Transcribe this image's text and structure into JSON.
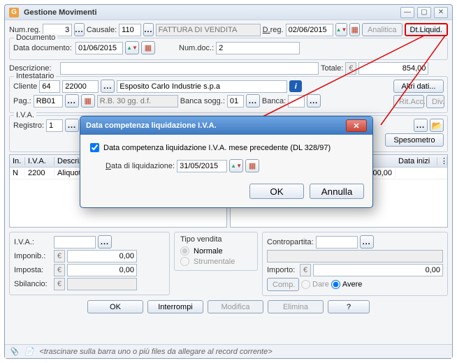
{
  "title": "Gestione Movimenti",
  "toprow": {
    "numreg_lbl": "Num.reg.",
    "numreg": "3",
    "causale_lbl": "Causale:",
    "causale": "110",
    "causale_desc": "FATTURA DI VENDITA",
    "dreg_lbl": "D.reg.",
    "dreg": "02/06/2015",
    "analitica": "Analitica",
    "dtliquid": "Dt.Liquid."
  },
  "documento": {
    "group": "Documento",
    "data_lbl": "Data documento:",
    "data": "01/06/2015",
    "numdoc_lbl": "Num.doc.:",
    "numdoc": "2"
  },
  "descr": {
    "lbl": "Descrizione:",
    "val": "",
    "tot_lbl": "Totale:",
    "cur": "€",
    "tot": "854,00"
  },
  "intest": {
    "group": "Intestatario",
    "cliente_lbl": "Cliente",
    "tipo": "64",
    "cod": "22000",
    "rag": "Esposito Carlo Industrie s.p.a",
    "altri": "Altri dati...",
    "rtacc": "Rit.Acc.",
    "div": "Div.",
    "pag_lbl": "Pag.:",
    "pag": "RB01",
    "rb": "R.B. 30 gg. d.f.",
    "bancasogg_lbl": "Banca sogg.:",
    "bancasogg": "01",
    "banca_lbl": "Banca:"
  },
  "iva": {
    "group": "I.V.A.",
    "reg_lbl": "Registro:",
    "reg": "1",
    "speso": "Spesometro"
  },
  "grid_left": {
    "headers": [
      "In.",
      "I.V.A.",
      "Descrizione"
    ],
    "row": [
      "N",
      "2200",
      "Aliquota 22%"
    ]
  },
  "grid_right": {
    "header_last": "Data inizi",
    "row_val": "700,00"
  },
  "totals": {
    "iva_lbl": "I.V.A.:",
    "imponib_lbl": "Imponib.:",
    "imponib": "0,00",
    "imposta_lbl": "Imposta:",
    "imposta": "0,00",
    "sbilancio_lbl": "Sbilancio:"
  },
  "tipo_vendita": {
    "group": "Tipo vendita",
    "normale": "Normale",
    "strumentale": "Strumentale"
  },
  "contropartita": {
    "group": "Contropartita:",
    "importo_lbl": "Importo:",
    "importo": "0,00",
    "comp": "Comp.",
    "dare": "Dare",
    "avere": "Avere"
  },
  "actions": {
    "ok": "OK",
    "interrompi": "Interrompi",
    "modifica": "Modifica",
    "elimina": "Elimina",
    "help": "?"
  },
  "statusbar": "<trascinare sulla barra uno o più files da allegare al record corrente>",
  "modal": {
    "title": "Data competenza liquidazione I.V.A.",
    "check": "Data competenza liquidazione I.V.A. mese precedente (DL 328/97)",
    "data_lbl": "Data di liquidazione:",
    "data": "31/05/2015",
    "ok": "OK",
    "annulla": "Annulla"
  }
}
